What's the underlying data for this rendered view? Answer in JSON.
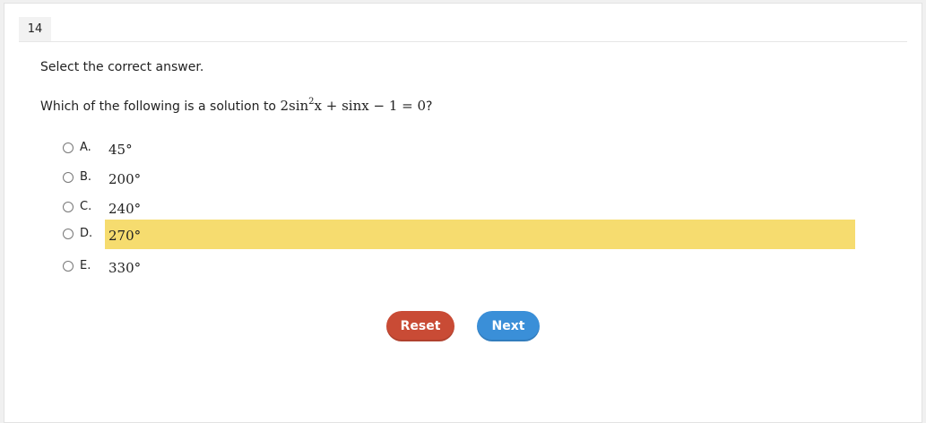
{
  "question_number": "14",
  "instruction": "Select the correct answer.",
  "question": {
    "prefix": "Which of the following is a solution to ",
    "math_a": "2sin",
    "math_sup": "2",
    "math_b": "x + sinx − 1 = 0",
    "suffix": "?"
  },
  "choices": [
    {
      "letter": "A.",
      "value": "45°",
      "selected": false
    },
    {
      "letter": "B.",
      "value": "200°",
      "selected": false
    },
    {
      "letter": "C.",
      "value": "240°",
      "selected": false
    },
    {
      "letter": "D.",
      "value": "270°",
      "selected": true
    },
    {
      "letter": "E.",
      "value": "330°",
      "selected": false
    }
  ],
  "buttons": {
    "reset_label": "Reset",
    "next_label": "Next"
  },
  "colors": {
    "highlight": "#f6dc6f",
    "reset": "#c94b35",
    "next": "#3a8fd8"
  }
}
